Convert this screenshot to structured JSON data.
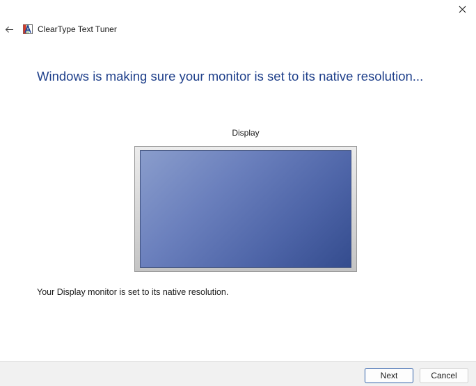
{
  "window": {
    "title": "ClearType Text Tuner"
  },
  "main": {
    "heading": "Windows is making sure your monitor is set to its native resolution...",
    "display_label": "Display",
    "status_text": "Your Display monitor is set to its native resolution."
  },
  "footer": {
    "next_label": "Next",
    "cancel_label": "Cancel"
  },
  "icons": {
    "back": "back-arrow-icon",
    "close": "close-icon",
    "app": "cleartype-icon"
  },
  "colors": {
    "heading": "#1e3f8a",
    "primary_border": "#2f5fa8",
    "screen_dark": "#344c8e",
    "screen_light": "#8a9dcc"
  }
}
